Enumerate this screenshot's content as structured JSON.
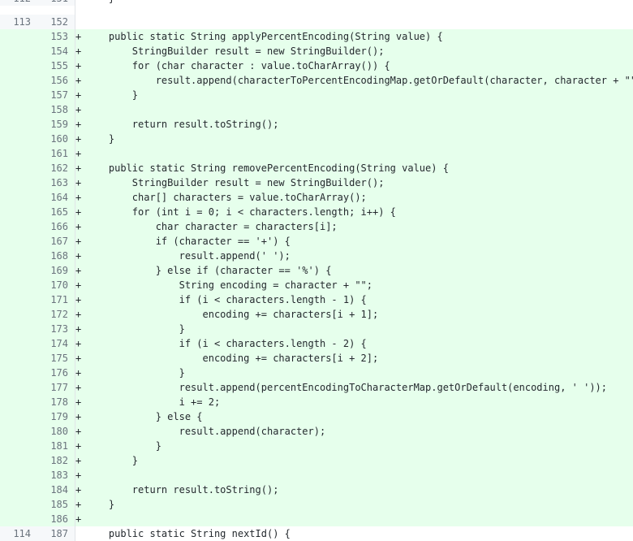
{
  "view": {
    "kind": "unified-diff",
    "language": "java",
    "colors": {
      "addition_bg": "#e6ffec",
      "context_bg": "#ffffff",
      "gutter_bg": "#f6f8fa",
      "gutter_text": "#6a737d",
      "code_text": "#24292e",
      "gutter_border": "#e1e4e8"
    },
    "markers": {
      "addition": "+",
      "context": " "
    }
  },
  "rows": [
    {
      "old": "112",
      "new": "151",
      "marker": "",
      "type": "context",
      "code": "    }",
      "clipped": true
    },
    {
      "old": "113",
      "new": "152",
      "marker": "",
      "type": "context",
      "code": ""
    },
    {
      "old": "",
      "new": "153",
      "marker": "+",
      "type": "addition",
      "code": "    public static String applyPercentEncoding(String value) {"
    },
    {
      "old": "",
      "new": "154",
      "marker": "+",
      "type": "addition",
      "code": "        StringBuilder result = new StringBuilder();"
    },
    {
      "old": "",
      "new": "155",
      "marker": "+",
      "type": "addition",
      "code": "        for (char character : value.toCharArray()) {"
    },
    {
      "old": "",
      "new": "156",
      "marker": "+",
      "type": "addition",
      "code": "            result.append(characterToPercentEncodingMap.getOrDefault(character, character + \"\"));"
    },
    {
      "old": "",
      "new": "157",
      "marker": "+",
      "type": "addition",
      "code": "        }"
    },
    {
      "old": "",
      "new": "158",
      "marker": "+",
      "type": "addition",
      "code": ""
    },
    {
      "old": "",
      "new": "159",
      "marker": "+",
      "type": "addition",
      "code": "        return result.toString();"
    },
    {
      "old": "",
      "new": "160",
      "marker": "+",
      "type": "addition",
      "code": "    }"
    },
    {
      "old": "",
      "new": "161",
      "marker": "+",
      "type": "addition",
      "code": ""
    },
    {
      "old": "",
      "new": "162",
      "marker": "+",
      "type": "addition",
      "code": "    public static String removePercentEncoding(String value) {"
    },
    {
      "old": "",
      "new": "163",
      "marker": "+",
      "type": "addition",
      "code": "        StringBuilder result = new StringBuilder();"
    },
    {
      "old": "",
      "new": "164",
      "marker": "+",
      "type": "addition",
      "code": "        char[] characters = value.toCharArray();"
    },
    {
      "old": "",
      "new": "165",
      "marker": "+",
      "type": "addition",
      "code": "        for (int i = 0; i < characters.length; i++) {"
    },
    {
      "old": "",
      "new": "166",
      "marker": "+",
      "type": "addition",
      "code": "            char character = characters[i];"
    },
    {
      "old": "",
      "new": "167",
      "marker": "+",
      "type": "addition",
      "code": "            if (character == '+') {"
    },
    {
      "old": "",
      "new": "168",
      "marker": "+",
      "type": "addition",
      "code": "                result.append(' ');"
    },
    {
      "old": "",
      "new": "169",
      "marker": "+",
      "type": "addition",
      "code": "            } else if (character == '%') {"
    },
    {
      "old": "",
      "new": "170",
      "marker": "+",
      "type": "addition",
      "code": "                String encoding = character + \"\";"
    },
    {
      "old": "",
      "new": "171",
      "marker": "+",
      "type": "addition",
      "code": "                if (i < characters.length - 1) {"
    },
    {
      "old": "",
      "new": "172",
      "marker": "+",
      "type": "addition",
      "code": "                    encoding += characters[i + 1];"
    },
    {
      "old": "",
      "new": "173",
      "marker": "+",
      "type": "addition",
      "code": "                }"
    },
    {
      "old": "",
      "new": "174",
      "marker": "+",
      "type": "addition",
      "code": "                if (i < characters.length - 2) {"
    },
    {
      "old": "",
      "new": "175",
      "marker": "+",
      "type": "addition",
      "code": "                    encoding += characters[i + 2];"
    },
    {
      "old": "",
      "new": "176",
      "marker": "+",
      "type": "addition",
      "code": "                }"
    },
    {
      "old": "",
      "new": "177",
      "marker": "+",
      "type": "addition",
      "code": "                result.append(percentEncodingToCharacterMap.getOrDefault(encoding, ' '));"
    },
    {
      "old": "",
      "new": "178",
      "marker": "+",
      "type": "addition",
      "code": "                i += 2;"
    },
    {
      "old": "",
      "new": "179",
      "marker": "+",
      "type": "addition",
      "code": "            } else {"
    },
    {
      "old": "",
      "new": "180",
      "marker": "+",
      "type": "addition",
      "code": "                result.append(character);"
    },
    {
      "old": "",
      "new": "181",
      "marker": "+",
      "type": "addition",
      "code": "            }"
    },
    {
      "old": "",
      "new": "182",
      "marker": "+",
      "type": "addition",
      "code": "        }"
    },
    {
      "old": "",
      "new": "183",
      "marker": "+",
      "type": "addition",
      "code": ""
    },
    {
      "old": "",
      "new": "184",
      "marker": "+",
      "type": "addition",
      "code": "        return result.toString();"
    },
    {
      "old": "",
      "new": "185",
      "marker": "+",
      "type": "addition",
      "code": "    }"
    },
    {
      "old": "",
      "new": "186",
      "marker": "+",
      "type": "addition",
      "code": ""
    },
    {
      "old": "114",
      "new": "187",
      "marker": "",
      "type": "context",
      "code": "    public static String nextId() {"
    }
  ]
}
